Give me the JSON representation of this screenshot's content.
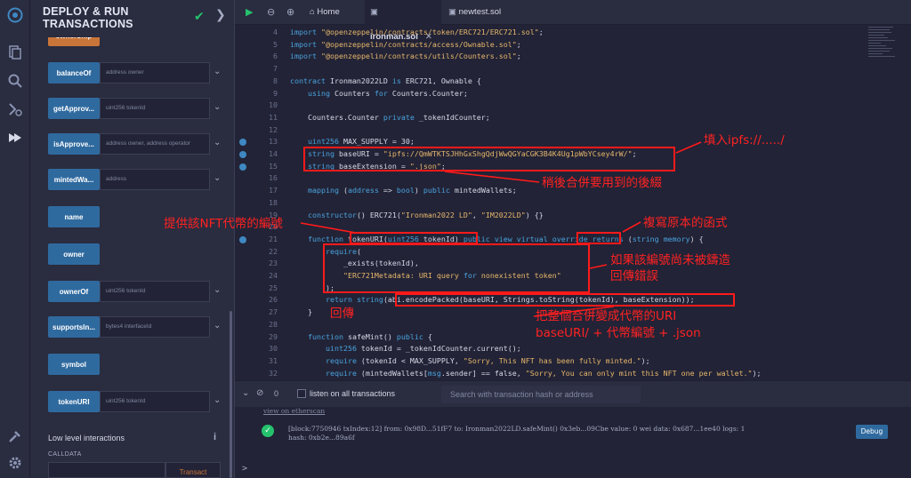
{
  "panel": {
    "title_line1": "DEPLOY & RUN",
    "title_line2": "TRANSACTIONS",
    "top_partial_label": "ownerShip",
    "functions": [
      {
        "label": "balanceOf",
        "placeholder": "address owner"
      },
      {
        "label": "getApprov...",
        "placeholder": "uint256 tokenId"
      },
      {
        "label": "isApprove...",
        "placeholder": "address owner, address operator"
      },
      {
        "label": "mintedWa...",
        "placeholder": "address"
      },
      {
        "label": "name",
        "placeholder": ""
      },
      {
        "label": "owner",
        "placeholder": ""
      },
      {
        "label": "ownerOf",
        "placeholder": "uint256 tokenId"
      },
      {
        "label": "supportsIn...",
        "placeholder": "bytes4 interfaceId"
      },
      {
        "label": "symbol",
        "placeholder": ""
      },
      {
        "label": "tokenURI",
        "placeholder": "uint256 tokenId"
      }
    ],
    "low_level": "Low level interactions",
    "calldata": "CALLDATA",
    "transact": "Transact"
  },
  "tabs": {
    "home": "Home",
    "file1": "ironman.sol",
    "file2": "newtest.sol"
  },
  "code": {
    "lines": [
      {
        "n": "4",
        "t": "import \"@openzeppelin/contracts/token/ERC721/ERC721.sol\";"
      },
      {
        "n": "5",
        "t": "import \"@openzeppelin/contracts/access/Ownable.sol\";"
      },
      {
        "n": "6",
        "t": "import \"@openzeppelin/contracts/utils/Counters.sol\";"
      },
      {
        "n": "7",
        "t": ""
      },
      {
        "n": "8",
        "t": "contract Ironman2022LD is ERC721, Ownable {"
      },
      {
        "n": "9",
        "t": "    using Counters for Counters.Counter;"
      },
      {
        "n": "10",
        "t": ""
      },
      {
        "n": "11",
        "t": "    Counters.Counter private _tokenIdCounter;"
      },
      {
        "n": "12",
        "t": ""
      },
      {
        "n": "13",
        "t": "    uint256 MAX_SUPPLY = 30;"
      },
      {
        "n": "14",
        "t": "    string baseURI = \"ipfs://QmWTKTSJHhGxShgQdjWwQGYaCGK3B4K4Ug1pWbYCsey4rW/\";"
      },
      {
        "n": "15",
        "t": "    string baseExtension = \".json\";"
      },
      {
        "n": "16",
        "t": ""
      },
      {
        "n": "17",
        "t": "    mapping (address => bool) public mintedWallets;"
      },
      {
        "n": "18",
        "t": ""
      },
      {
        "n": "19",
        "t": "    constructor() ERC721(\"Ironman2022 LD\", \"IM2022LD\") {}"
      },
      {
        "n": "20",
        "t": ""
      },
      {
        "n": "21",
        "t": "    function tokenURI(uint256 tokenId) public view virtual override returns (string memory) {"
      },
      {
        "n": "22",
        "t": "        require("
      },
      {
        "n": "23",
        "t": "            _exists(tokenId),"
      },
      {
        "n": "24",
        "t": "            \"ERC721Metadata: URI query for nonexistent token\""
      },
      {
        "n": "25",
        "t": "        );"
      },
      {
        "n": "26",
        "t": "        return string(abi.encodePacked(baseURI, Strings.toString(tokenId), baseExtension));"
      },
      {
        "n": "27",
        "t": "    }"
      },
      {
        "n": "28",
        "t": ""
      },
      {
        "n": "29",
        "t": "    function safeMint() public {"
      },
      {
        "n": "30",
        "t": "        uint256 tokenId = _tokenIdCounter.current();"
      },
      {
        "n": "31",
        "t": "        require (tokenId < MAX_SUPPLY, \"Sorry, This NFT has been fully minted.\");"
      },
      {
        "n": "32",
        "t": "        require (mintedWallets[msg.sender] == false, \"Sorry, You can only mint this NFT one per wallet.\");"
      }
    ]
  },
  "annotations": {
    "fill_ipfs": "填入ipfs://...../",
    "combine_later": "稍後合併要用到的後綴",
    "provide_id": "提供該NFT代幣的編號",
    "copy_func": "複寫原本的函式",
    "not_minted_line1": "如果該編號尚未被鑄造",
    "not_minted_line2": "回傳錯誤",
    "return_label": "回傳",
    "merge_line1": "把整個合併變成代幣的URI",
    "merge_line2": "baseURI/ + 代幣編號 + .json"
  },
  "terminal": {
    "count": "0",
    "listen": "listen on all transactions",
    "search_placeholder": "Search with transaction hash or address",
    "view_link": "view on etherscan",
    "tx_line1": "[block:7750946 txIndex:12] from: 0x98D...51fF7 to: Ironman2022LD.safeMint() 0x3eb...09Cbe value: 0 wei data: 0x687...1ee40 logs: 1",
    "tx_line2": "hash: 0xb2e...89a6f",
    "debug": "Debug",
    "prompt": ">"
  }
}
